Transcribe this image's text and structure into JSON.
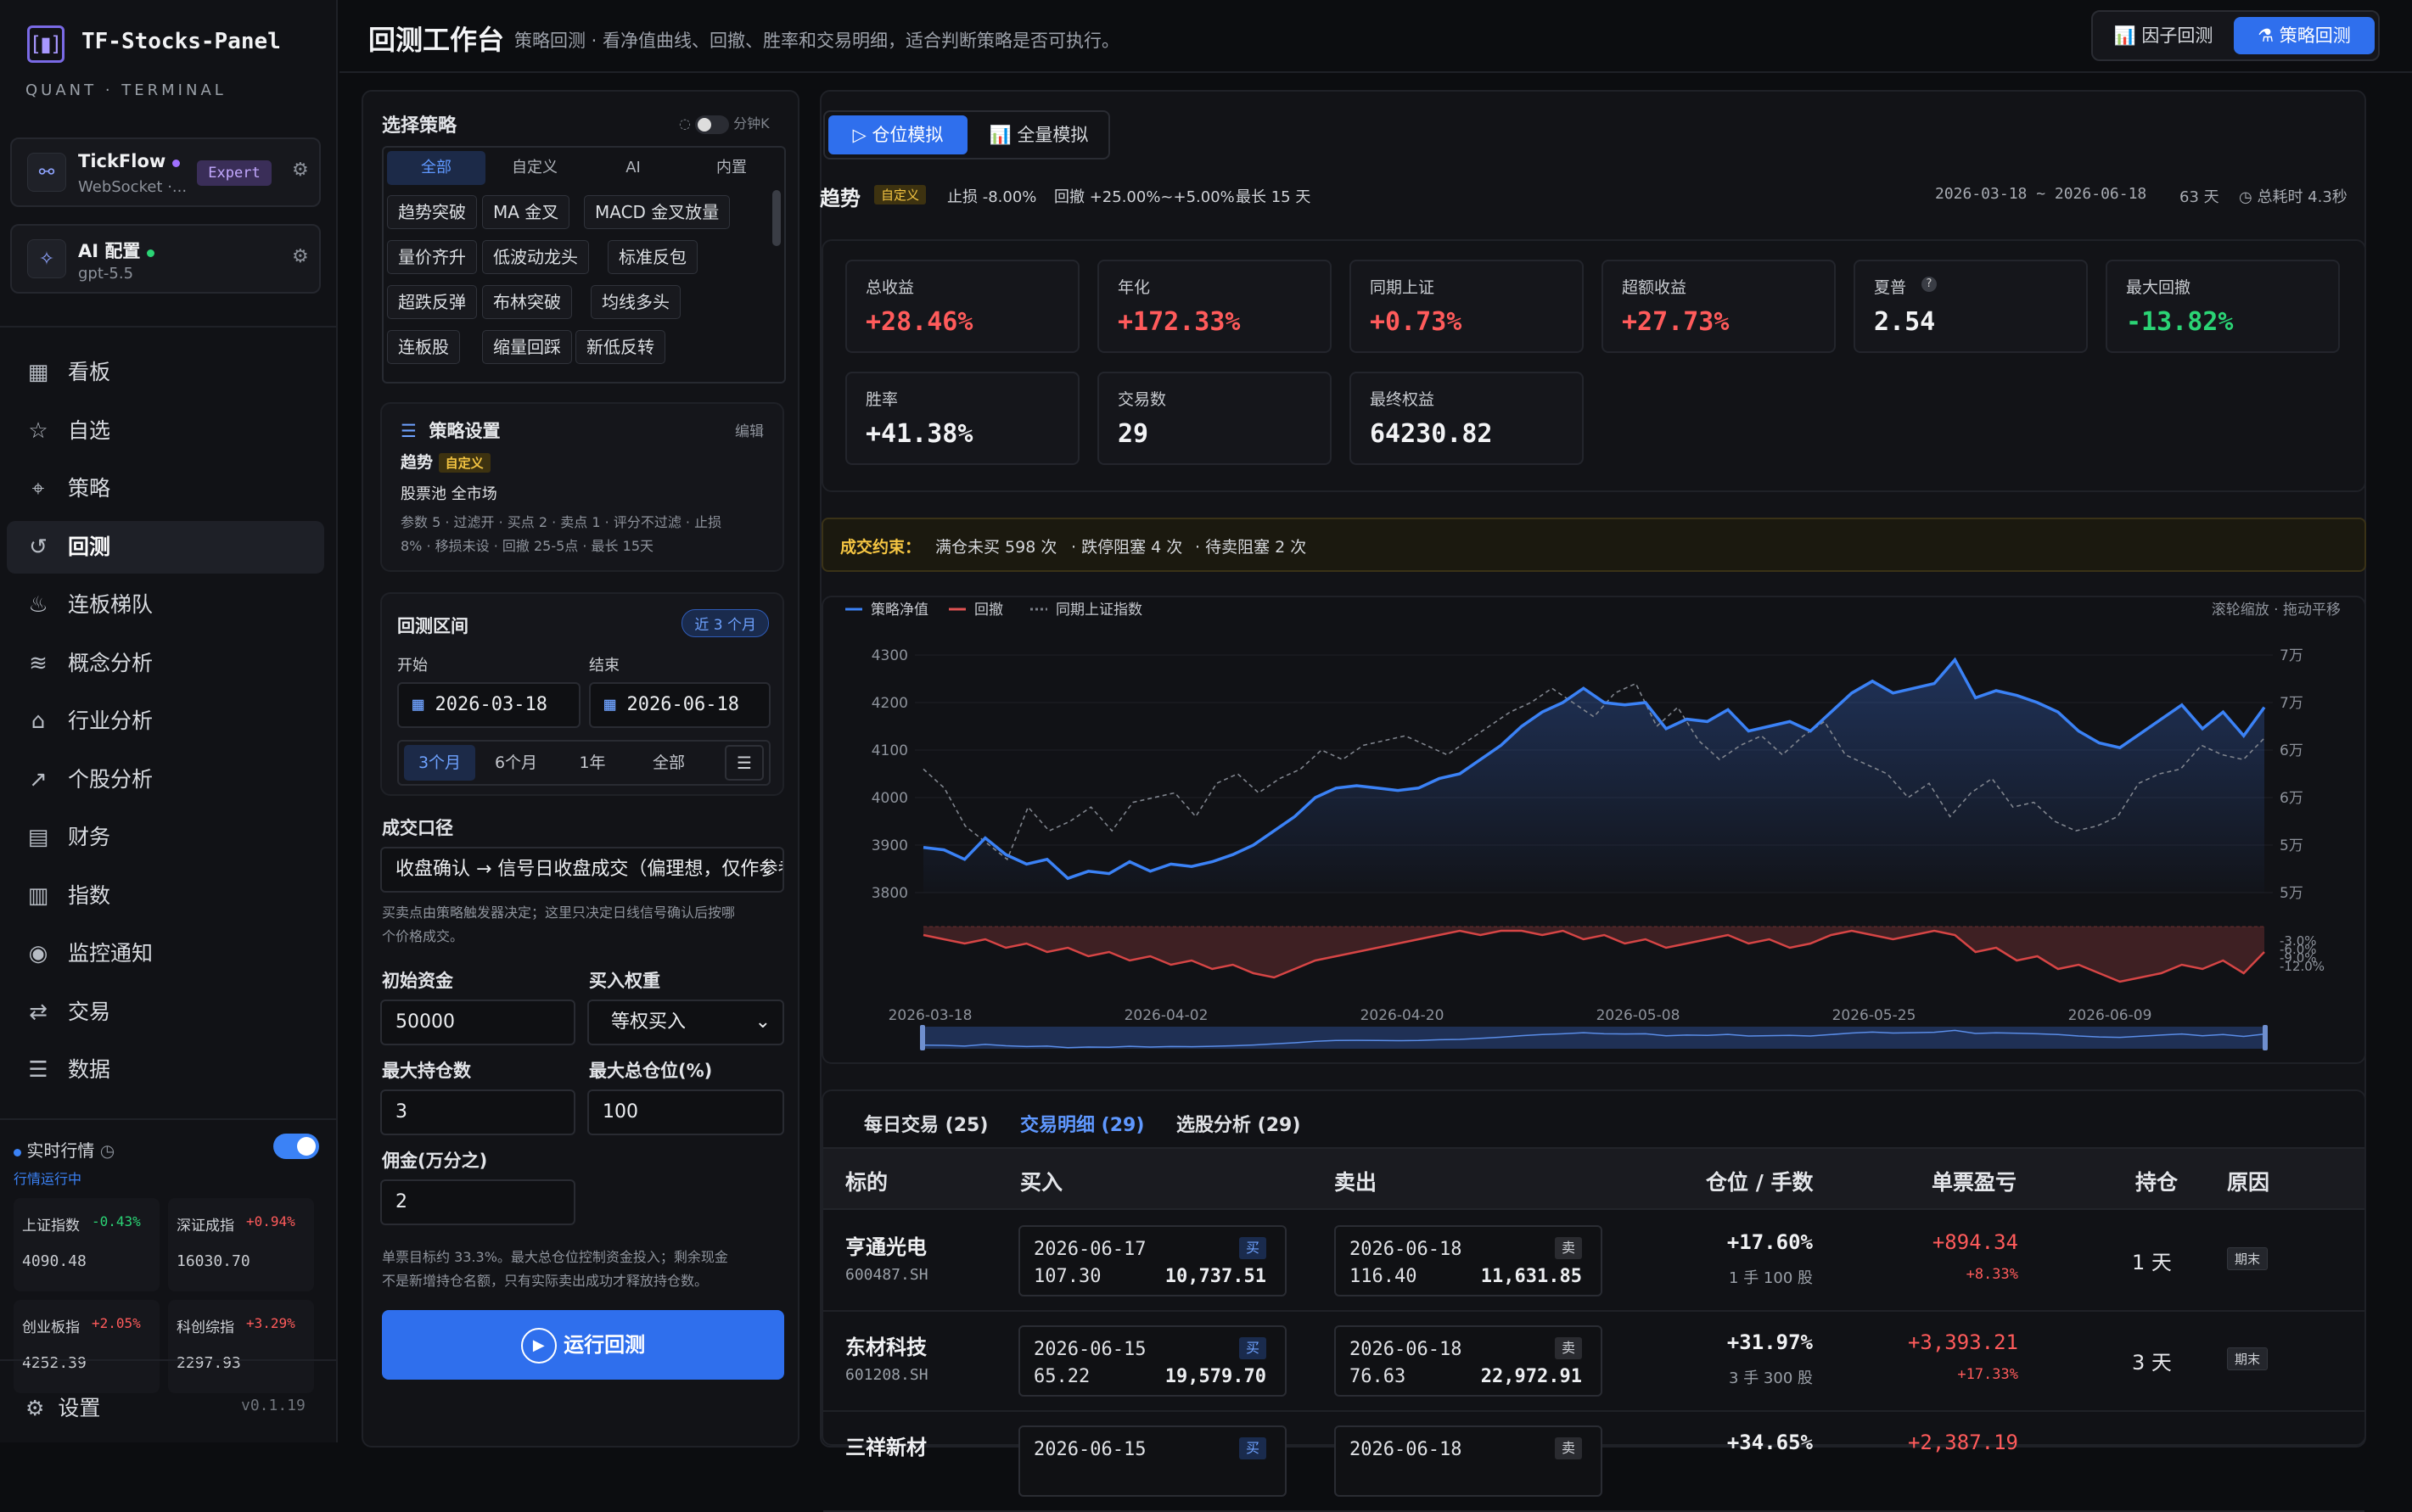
{
  "app": {
    "title": "TF-Stocks-Panel",
    "subtitle": "QUANT · TERMINAL",
    "version": "v0.1.19"
  },
  "tickflow": {
    "name": "TickFlow",
    "sub": "WebSocket ·...",
    "badge": "Expert"
  },
  "ai": {
    "name": "AI 配置",
    "sub": "gpt-5.5"
  },
  "nav": [
    {
      "label": "看板",
      "icon": "dashboard-icon"
    },
    {
      "label": "自选",
      "icon": "star-icon"
    },
    {
      "label": "策略",
      "icon": "scan-icon"
    },
    {
      "label": "回测",
      "icon": "history-icon"
    },
    {
      "label": "连板梯队",
      "icon": "flame-icon"
    },
    {
      "label": "概念分析",
      "icon": "layers-icon"
    },
    {
      "label": "行业分析",
      "icon": "bank-icon"
    },
    {
      "label": "个股分析",
      "icon": "trend-icon"
    },
    {
      "label": "财务",
      "icon": "document-icon"
    },
    {
      "label": "指数",
      "icon": "bar-chart-icon"
    },
    {
      "label": "监控通知",
      "icon": "radio-icon"
    },
    {
      "label": "交易",
      "icon": "exchange-icon"
    },
    {
      "label": "数据",
      "icon": "database-icon"
    }
  ],
  "market": {
    "title": "实时行情",
    "status": "行情运行中",
    "indices": [
      {
        "name": "上证指数",
        "change": "-0.43%",
        "value": "4090.48",
        "dir": "down"
      },
      {
        "name": "深证成指",
        "change": "+0.94%",
        "value": "16030.70",
        "dir": "up"
      },
      {
        "name": "创业板指",
        "change": "+2.05%",
        "value": "4252.39",
        "dir": "up"
      },
      {
        "name": "科创综指",
        "change": "+3.29%",
        "value": "2297.93",
        "dir": "up"
      }
    ]
  },
  "settings_label": "设置",
  "header": {
    "title": "回测工作台",
    "desc": "策略回测 · 看净值曲线、回撤、胜率和交易明细，适合判断策略是否可执行。",
    "btn_factor": "因子回测",
    "btn_strategy": "策略回测"
  },
  "strategy": {
    "title": "选择策略",
    "minute_label": "分钟K",
    "tabs": [
      "全部",
      "自定义",
      "AI",
      "内置"
    ],
    "chips": [
      [
        "趋势突破",
        "MA 金叉",
        "MACD 金叉放量"
      ],
      [
        "量价齐升",
        "低波动龙头",
        "标准反包"
      ],
      [
        "超跌反弹",
        "布林突破",
        "均线多头"
      ],
      [
        "连板股",
        "缩量回踩",
        "新低反转"
      ]
    ]
  },
  "settings": {
    "title": "策略设置",
    "edit": "编辑",
    "name": "趋势",
    "tag": "自定义",
    "pool": "股票池 全市场",
    "params": "参数 5 · 过滤开 · 买点 2 · 卖点 1 · 评分不过滤 · 止损",
    "params2": "8% · 移损未设 · 回撤 25-5点 · 最长 15天"
  },
  "range": {
    "title": "回测区间",
    "recent": "近 3 个月",
    "start_label": "开始",
    "end_label": "结束",
    "start": "2026-03-18",
    "end": "2026-06-18",
    "presets": [
      "3个月",
      "6个月",
      "1年",
      "全部"
    ]
  },
  "fill": {
    "title": "成交口径",
    "value": "收盘确认 → 信号日收盘成交（偏理想，仅作参考）",
    "note": "买卖点由策略触发器决定；这里只决定日线信号确认后按哪",
    "note2": "个价格成交。"
  },
  "form": {
    "capital_label": "初始资金",
    "capital": "50000",
    "weight_label": "买入权重",
    "weight": "等权买入",
    "maxpos_label": "最大持仓数",
    "maxpos": "3",
    "maxpct_label": "最大总仓位(%)",
    "maxpct": "100",
    "fee_label": "佣金(万分之)",
    "fee": "2",
    "hint": "单票目标约 33.3%。最大总仓位控制资金投入；剩余现金",
    "hint2": "不是新增持仓名额，只有实际卖出成功才释放持仓数。",
    "run": "运行回测"
  },
  "mode": {
    "position": "仓位模拟",
    "full": "全量模拟"
  },
  "summary": {
    "name": "趋势",
    "tag": "自定义",
    "stop": "止损 -8.00%",
    "drawdown": "回撤 +25.00%~+5.00%",
    "max": "最长 15 天",
    "range": "2026-03-18 ~ 2026-06-18",
    "days": "63 天",
    "elapsed": "总耗时 4.3秒"
  },
  "stats": [
    {
      "k": "总收益",
      "v": "+28.46%",
      "c": "up"
    },
    {
      "k": "年化",
      "v": "+172.33%",
      "c": "up"
    },
    {
      "k": "同期上证",
      "v": "+0.73%",
      "c": "up"
    },
    {
      "k": "超额收益",
      "v": "+27.73%",
      "c": "up"
    },
    {
      "k": "夏普",
      "v": "2.54",
      "c": "plain",
      "help": "?"
    },
    {
      "k": "最大回撤",
      "v": "-13.82%",
      "c": "down"
    },
    {
      "k": "胜率",
      "v": "+41.38%",
      "c": "plain"
    },
    {
      "k": "交易数",
      "v": "29",
      "c": "plain"
    },
    {
      "k": "最终权益",
      "v": "64230.82",
      "c": "plain"
    }
  ],
  "constraint": {
    "label": "成交约束：",
    "t1": "满仓未买 598 次",
    "t2": "· 跌停阻塞 4 次",
    "t3": "· 待卖阻塞 2 次"
  },
  "chart_data": {
    "type": "line",
    "legend": [
      "策略净值",
      "回撤",
      "同期上证指数"
    ],
    "hint": "滚轮缩放 · 拖动平移",
    "y_left": [
      "4300",
      "4200",
      "4100",
      "4000",
      "3900",
      "3800"
    ],
    "y_right": [
      "7万",
      "7万",
      "6万",
      "6万",
      "5万",
      "5万"
    ],
    "dd_ticks": [
      "-3.0%",
      "-6.0%",
      "-9.0%",
      "-12.0%"
    ],
    "x_labels": [
      "2026-03-18",
      "2026-04-02",
      "2026-04-20",
      "2026-05-08",
      "2026-05-25",
      "2026-06-09"
    ],
    "strategy": [
      3895,
      3890,
      3870,
      3915,
      3880,
      3860,
      3870,
      3830,
      3845,
      3840,
      3865,
      3845,
      3860,
      3855,
      3865,
      3880,
      3900,
      3930,
      3960,
      4000,
      4020,
      4025,
      4020,
      4015,
      4020,
      4040,
      4050,
      4080,
      4110,
      4150,
      4180,
      4200,
      4230,
      4200,
      4195,
      4200,
      4145,
      4165,
      4160,
      4185,
      4140,
      4150,
      4160,
      4140,
      4180,
      4220,
      4245,
      4220,
      4230,
      4240,
      4290,
      4210,
      4225,
      4215,
      4200,
      4180,
      4140,
      4115,
      4105,
      4135,
      4165,
      4195,
      4145,
      4180,
      4130,
      4190
    ],
    "index": [
      4060,
      4020,
      3940,
      3905,
      3870,
      3980,
      3930,
      3950,
      3980,
      3930,
      3990,
      4000,
      4010,
      3960,
      4030,
      4050,
      4010,
      4040,
      4060,
      4100,
      4080,
      4110,
      4120,
      4130,
      4110,
      4090,
      4120,
      4150,
      4180,
      4200,
      4230,
      4200,
      4170,
      4220,
      4240,
      4150,
      4190,
      4120,
      4080,
      4110,
      4130,
      4090,
      4130,
      4160,
      4090,
      4070,
      4050,
      4000,
      4030,
      3960,
      4010,
      4040,
      3980,
      3990,
      3950,
      3930,
      3940,
      3960,
      4030,
      4050,
      4060,
      4110,
      4090,
      4080,
      4125
    ],
    "drawdown": [
      -2,
      -3,
      -4,
      -3,
      -5,
      -4,
      -6,
      -5,
      -7,
      -6,
      -8,
      -7,
      -9,
      -8,
      -10,
      -9,
      -11,
      -12,
      -10,
      -8,
      -7,
      -6,
      -5,
      -4,
      -3,
      -2,
      -1,
      -2,
      -1,
      -1,
      -2,
      -1,
      -3,
      -2,
      -4,
      -3,
      -5,
      -4,
      -3,
      -2,
      -4,
      -3,
      -5,
      -4,
      -2,
      -1,
      -2,
      -3,
      -2,
      -1,
      -2,
      -6,
      -5,
      -8,
      -7,
      -10,
      -9,
      -11,
      -13,
      -12,
      -11,
      -9,
      -10,
      -8,
      -11,
      -6
    ]
  },
  "trades_tabs": [
    "每日交易 (25)",
    "交易明细 (29)",
    "选股分析 (29)"
  ],
  "table": {
    "headers": [
      "标的",
      "买入",
      "卖出",
      "仓位 / 手数",
      "单票盈亏",
      "持仓",
      "原因"
    ],
    "rows": [
      {
        "name": "亨通光电",
        "code": "600487.SH",
        "bdate": "2026-06-17",
        "bprice": "107.30",
        "bamt": "10,737.51",
        "sdate": "2026-06-18",
        "sprice": "116.40",
        "samt": "11,631.85",
        "pos": "+17.60%",
        "lots": "1 手 100 股",
        "pnl": "+894.34",
        "pnlp": "+8.33%",
        "hold": "1 天",
        "reason": "期末"
      },
      {
        "name": "东材科技",
        "code": "601208.SH",
        "bdate": "2026-06-15",
        "bprice": "65.22",
        "bamt": "19,579.70",
        "sdate": "2026-06-18",
        "sprice": "76.63",
        "samt": "22,972.91",
        "pos": "+31.97%",
        "lots": "3 手 300 股",
        "pnl": "+3,393.21",
        "pnlp": "+17.33%",
        "hold": "3 天",
        "reason": "期末"
      },
      {
        "name": "三祥新材",
        "code": "",
        "bdate": "2026-06-15",
        "bprice": "",
        "bamt": "",
        "sdate": "2026-06-18",
        "sprice": "",
        "samt": "",
        "pos": "+34.65%",
        "lots": "",
        "pnl": "+2,387.19",
        "pnlp": "",
        "hold": "",
        "reason": ""
      }
    ],
    "buy_tag": "买",
    "sell_tag": "卖"
  }
}
